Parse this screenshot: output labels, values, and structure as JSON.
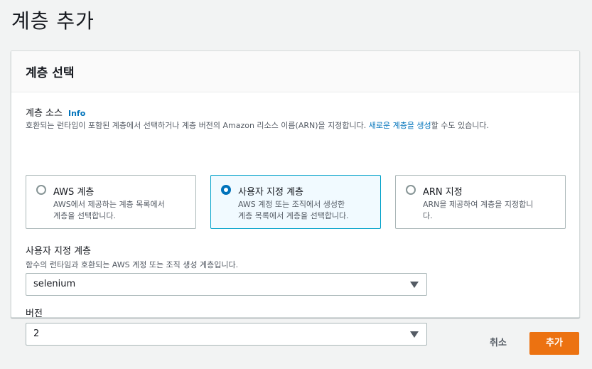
{
  "page": {
    "title": "계층 추가"
  },
  "panel": {
    "title": "계층 선택"
  },
  "layer_source": {
    "label": "계층 소스",
    "info": "Info",
    "description_before": "호환되는 런타임이 포함된 계층에서 선택하거나 계층 버전의 Amazon 리소스 이름(ARN)을 지정합니다. ",
    "description_link": "새로운 계층을 생성",
    "description_after": "할 수도 있습니다.",
    "options": [
      {
        "title": "AWS 계층",
        "desc_line1": "AWS에서 제공하는 계층 목록에서",
        "desc_line2": "계층을 선택합니다.",
        "selected": false
      },
      {
        "title": "사용자 지정 계층",
        "desc_line1": "AWS 계정 또는 조직에서 생성한",
        "desc_line2": "계층 목록에서 계층을 선택합니다.",
        "selected": true
      },
      {
        "title": "ARN 지정",
        "desc_line1": "ARN을 제공하여 계층을 지정합니",
        "desc_line2": "다.",
        "selected": false
      }
    ]
  },
  "custom_layer": {
    "label": "사용자 지정 계층",
    "description": "함수의 런타임과 호환되는 AWS 계정 또는 조직 생성 계층입니다.",
    "value": "selenium"
  },
  "version": {
    "label": "버전",
    "value": "2"
  },
  "footer": {
    "cancel": "취소",
    "add": "추가"
  },
  "colors": {
    "accent": "#0073bb",
    "primary_button": "#ec7211",
    "selected_tile_border": "#00a1c9"
  }
}
